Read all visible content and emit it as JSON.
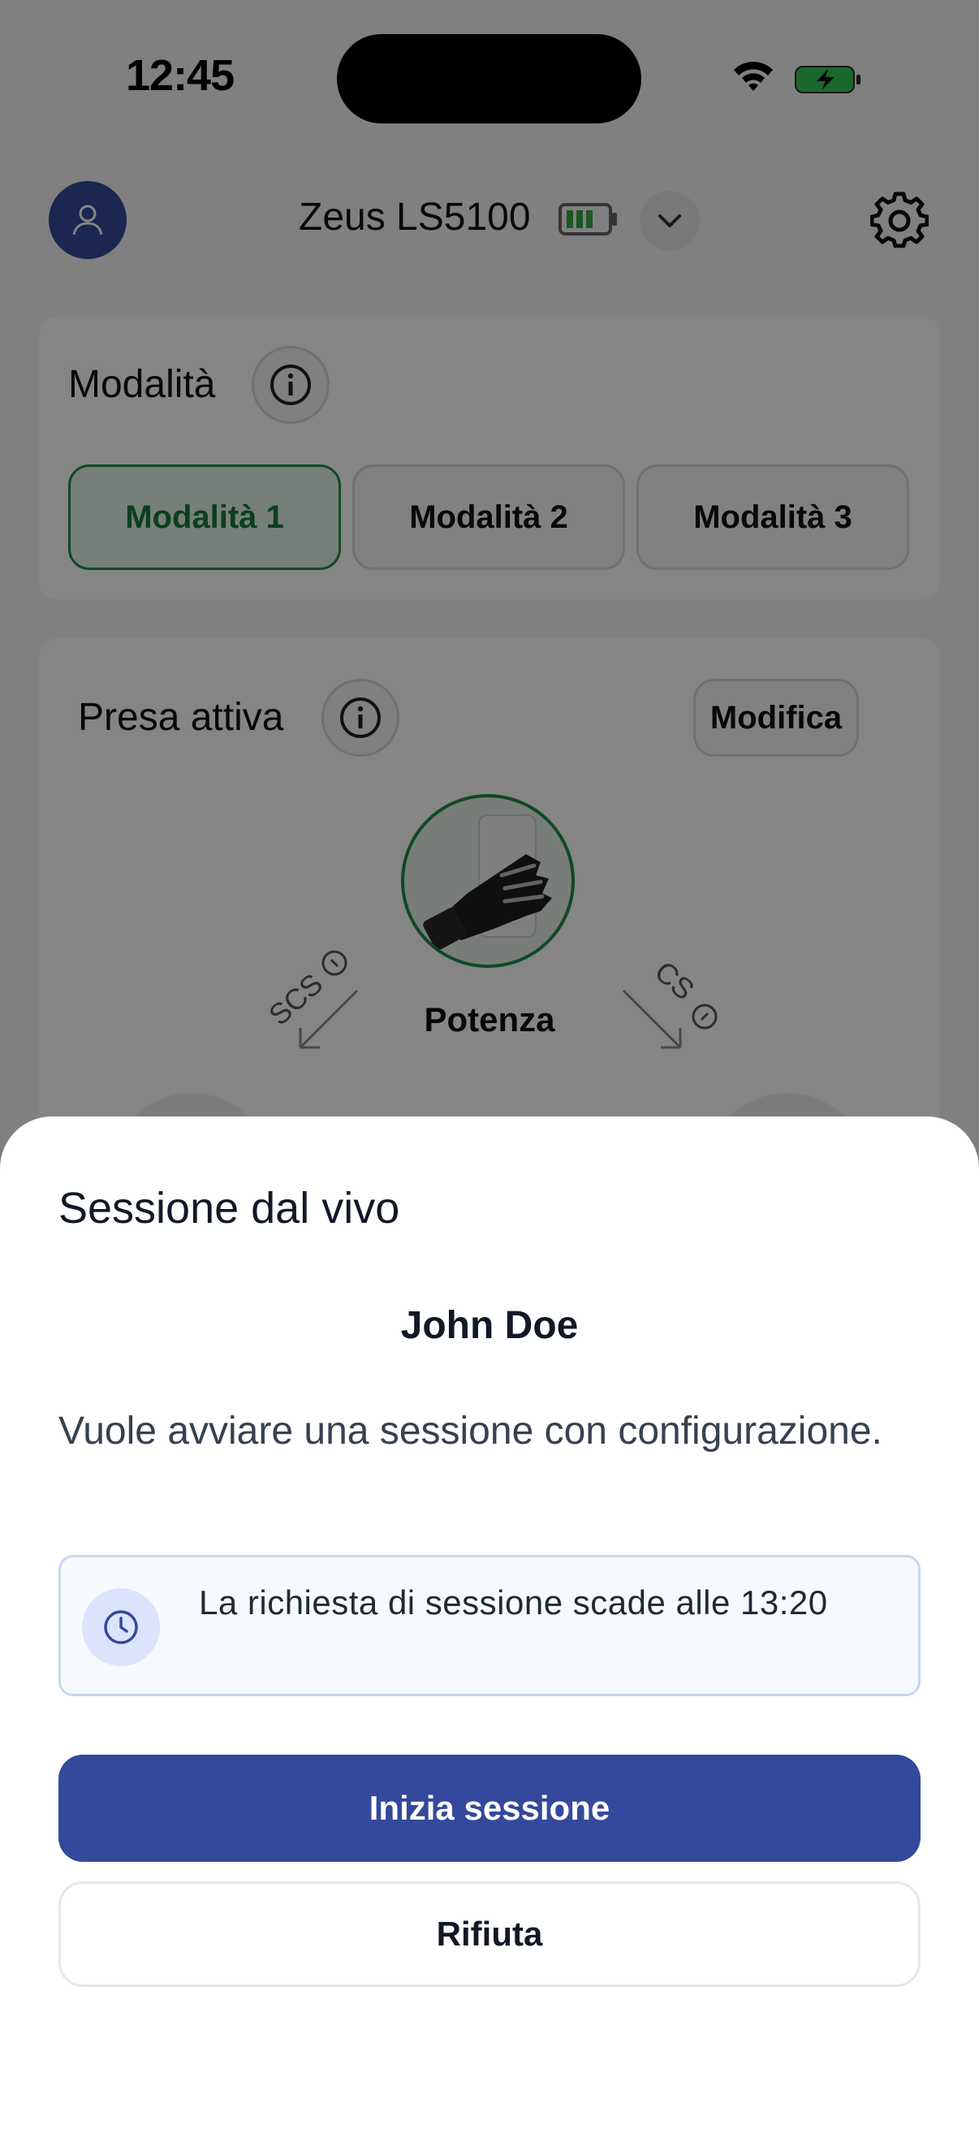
{
  "status_bar": {
    "time": "12:45"
  },
  "header": {
    "device_name": "Zeus LS5100"
  },
  "mode_card": {
    "title": "Modalità",
    "modes": [
      {
        "label": "Modalità 1",
        "active": true
      },
      {
        "label": "Modalità 2",
        "active": false
      },
      {
        "label": "Modalità 3",
        "active": false
      }
    ]
  },
  "grip_card": {
    "title": "Presa attiva",
    "edit_label": "Modifica",
    "grip_name": "Potenza",
    "left_label": "SCS",
    "right_label": "CS"
  },
  "sheet": {
    "title": "Sessione dal vivo",
    "requester": "John Doe",
    "description": "Vuole avviare una sessione con configurazione.",
    "notice": "La richiesta di sessione scade alle 13:20",
    "primary_label": "Inizia sessione",
    "secondary_label": "Rifiuta"
  },
  "colors": {
    "primary": "#34499b",
    "active_green": "#1f8a4c",
    "notice_bg": "#f6f9fe"
  }
}
